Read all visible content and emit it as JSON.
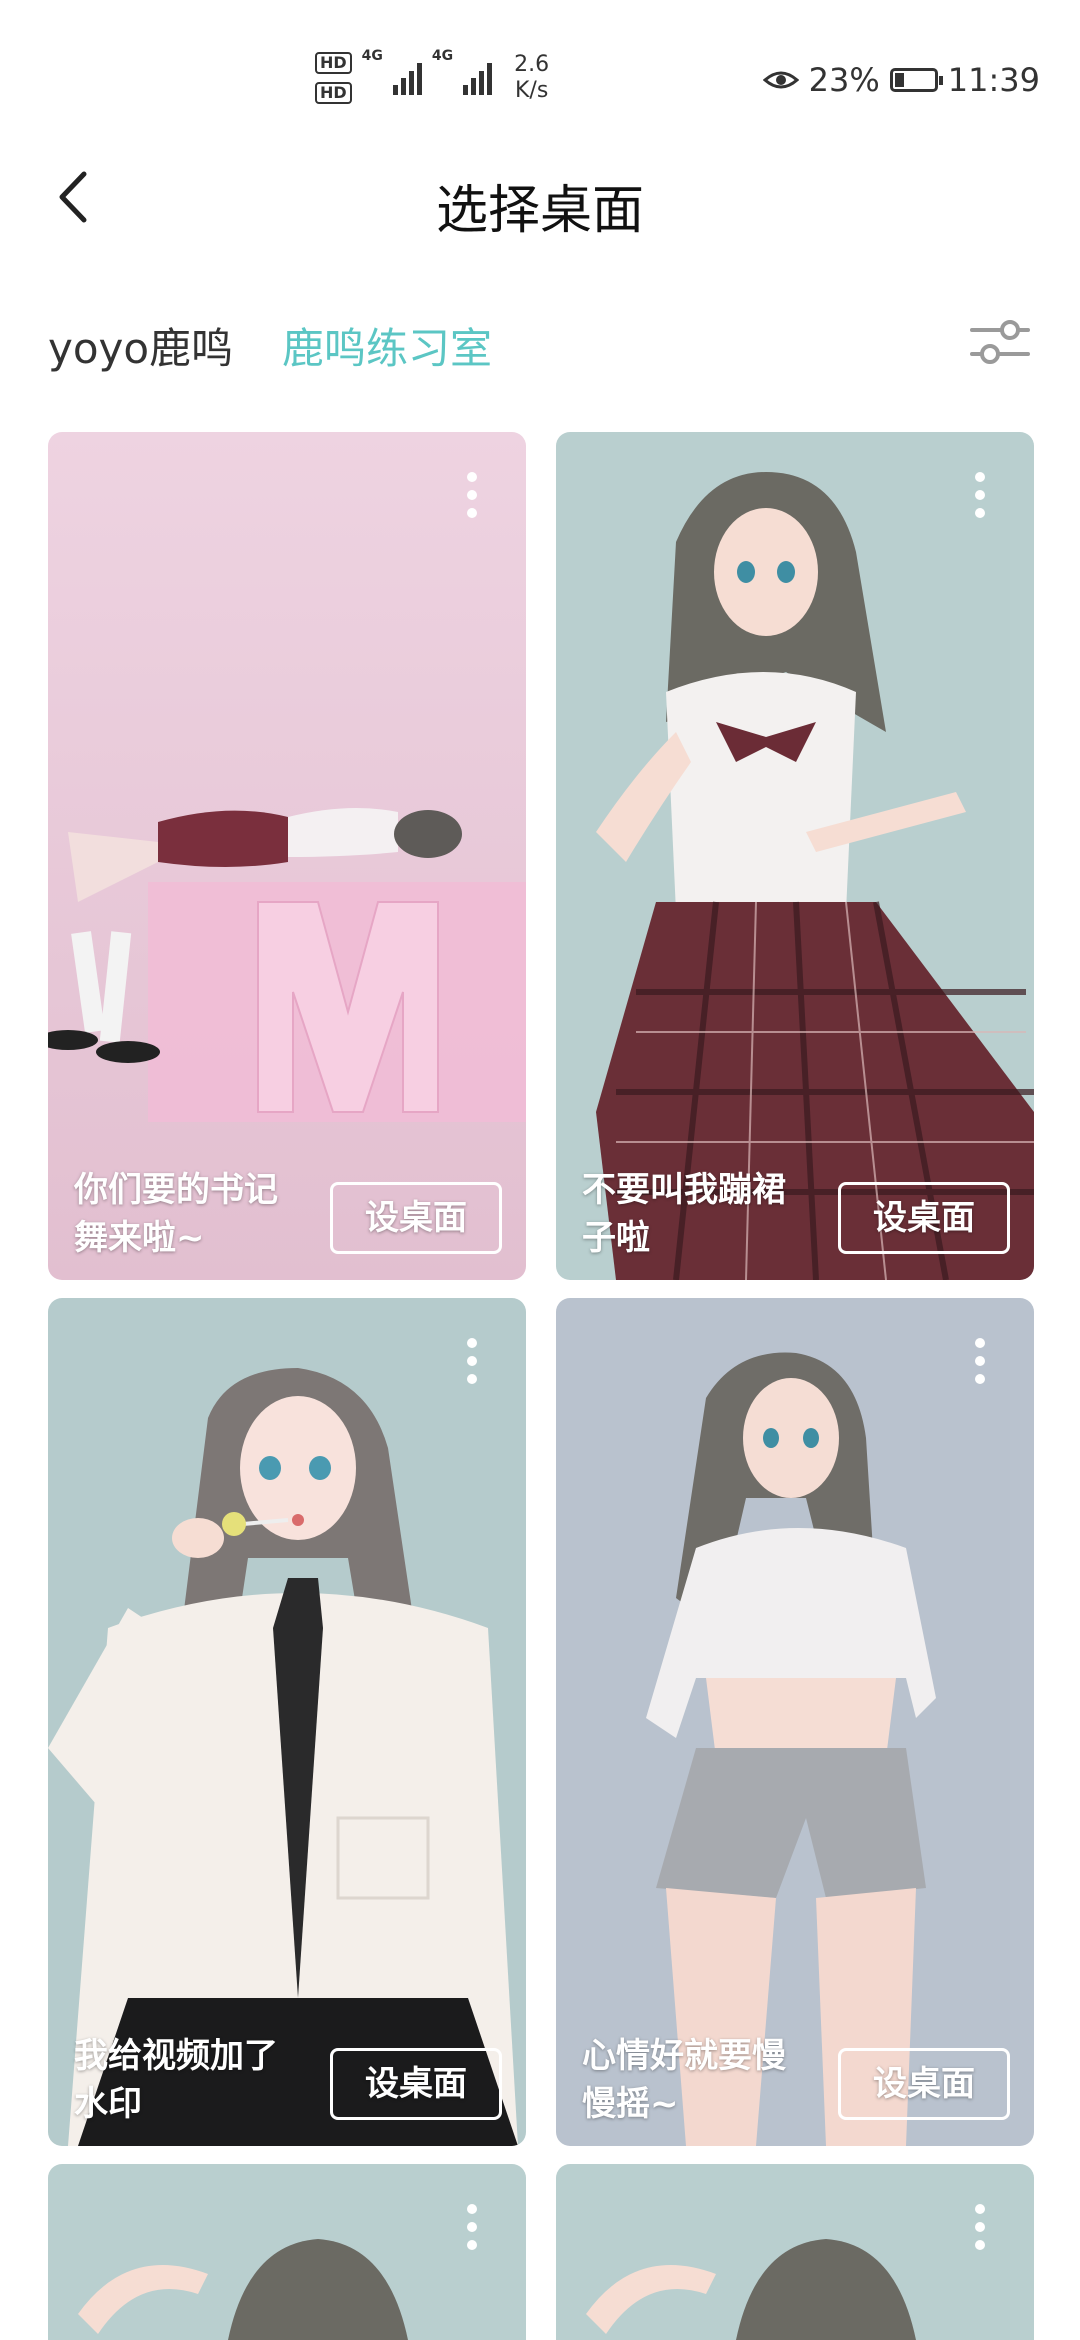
{
  "status_bar": {
    "hd1": "HD",
    "hd2": "HD",
    "net1": "4G",
    "net2": "4G",
    "speed_value": "2.6",
    "speed_unit": "K/s",
    "battery_percent": "23%",
    "battery_level": 0.23,
    "time": "11:39"
  },
  "header": {
    "title": "选择桌面"
  },
  "tabs": [
    {
      "label": "yoyo鹿鸣",
      "active": false
    },
    {
      "label": "鹿鸣练习室",
      "active": true
    }
  ],
  "colors": {
    "accent": "#5bc6c4"
  },
  "cards": [
    {
      "caption": "你们要的书记舞来啦~",
      "button": "设桌面",
      "background": "#e9c9d9"
    },
    {
      "caption": "不要叫我蹦裙子啦",
      "button": "设桌面",
      "background": "#b9cfcf"
    },
    {
      "caption": "我给视频加了水印",
      "button": "设桌面",
      "background": "#b5cbcc"
    },
    {
      "caption": "心情好就要慢慢摇~",
      "button": "设桌面",
      "background": "#b9c2ce"
    },
    {
      "caption": "",
      "button": "",
      "background": "#b9cfcf"
    },
    {
      "caption": "",
      "button": "",
      "background": "#b9cfcf"
    }
  ]
}
